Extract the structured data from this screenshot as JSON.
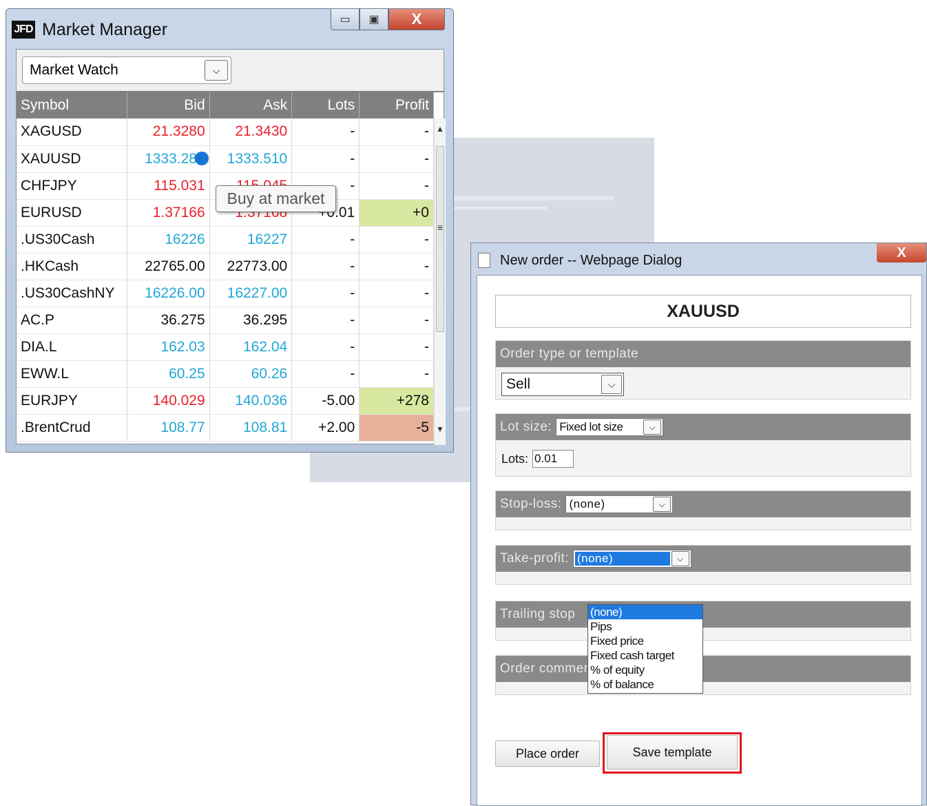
{
  "market_manager": {
    "logo": "JFD",
    "title": "Market Manager",
    "window_buttons": {
      "minimize": "▭",
      "maximize": "▣",
      "close": "X"
    },
    "view_select": "Market Watch",
    "columns": [
      "Symbol",
      "Bid",
      "Ask",
      "Lots",
      "Profit"
    ],
    "rows": [
      {
        "symbol": "XAGUSD",
        "bid": "21.3280",
        "ask": "21.3430",
        "lots": "-",
        "profit": "-"
      },
      {
        "symbol": "XAUUSD",
        "bid": "1333.280",
        "ask": "1333.510",
        "lots": "-",
        "profit": "-"
      },
      {
        "symbol": "CHFJPY",
        "bid": "115.031",
        "ask": "115.045",
        "lots": "-",
        "profit": "-"
      },
      {
        "symbol": "EURUSD",
        "bid": "1.37166",
        "ask": "1.37168",
        "lots": "+0.01",
        "profit": "+0"
      },
      {
        "symbol": ".US30Cash",
        "bid": "16226",
        "ask": "16227",
        "lots": "-",
        "profit": "-"
      },
      {
        "symbol": ".HKCash",
        "bid": "22765.00",
        "ask": "22773.00",
        "lots": "-",
        "profit": "-"
      },
      {
        "symbol": ".US30CashNY",
        "bid": "16226.00",
        "ask": "16227.00",
        "lots": "-",
        "profit": "-"
      },
      {
        "symbol": "AC.P",
        "bid": "36.275",
        "ask": "36.295",
        "lots": "-",
        "profit": "-"
      },
      {
        "symbol": "DIA.L",
        "bid": "162.03",
        "ask": "162.04",
        "lots": "-",
        "profit": "-"
      },
      {
        "symbol": "EWW.L",
        "bid": "60.25",
        "ask": "60.26",
        "lots": "-",
        "profit": "-"
      },
      {
        "symbol": "EURJPY",
        "bid": "140.029",
        "ask": "140.036",
        "lots": "-5.00",
        "profit": "+278"
      },
      {
        "symbol": ".BrentCrud",
        "bid": "108.77",
        "ask": "108.81",
        "lots": "+2.00",
        "profit": "-5"
      }
    ],
    "tooltip": "Buy at market",
    "colors": {
      "down": "#e8212b",
      "up": "#21a7d6",
      "profit_positive": "#d9e8a0",
      "profit_negative": "#e6b09a"
    }
  },
  "order_dialog": {
    "title": "New order -- Webpage Dialog",
    "close": "X",
    "symbol": "XAUUSD",
    "order_type": {
      "label": "Order type or template",
      "value": "Sell"
    },
    "lot_size": {
      "label": "Lot size:",
      "mode": "Fixed lot size",
      "lots_label": "Lots:",
      "lots_value": "0.01"
    },
    "stop_loss": {
      "label": "Stop-loss:",
      "value": "(none)"
    },
    "take_profit": {
      "label": "Take-profit:",
      "value": "(none)",
      "options": [
        "(none)",
        "Pips",
        "Fixed price",
        "Fixed cash target",
        "% of equity",
        "% of balance"
      ]
    },
    "trailing_stop": {
      "label": "Trailing stop"
    },
    "order_comment": {
      "label": "Order comment"
    },
    "buttons": {
      "place_order": "Place order",
      "save_template": "Save template"
    },
    "highlight_color": "#e3131c"
  }
}
